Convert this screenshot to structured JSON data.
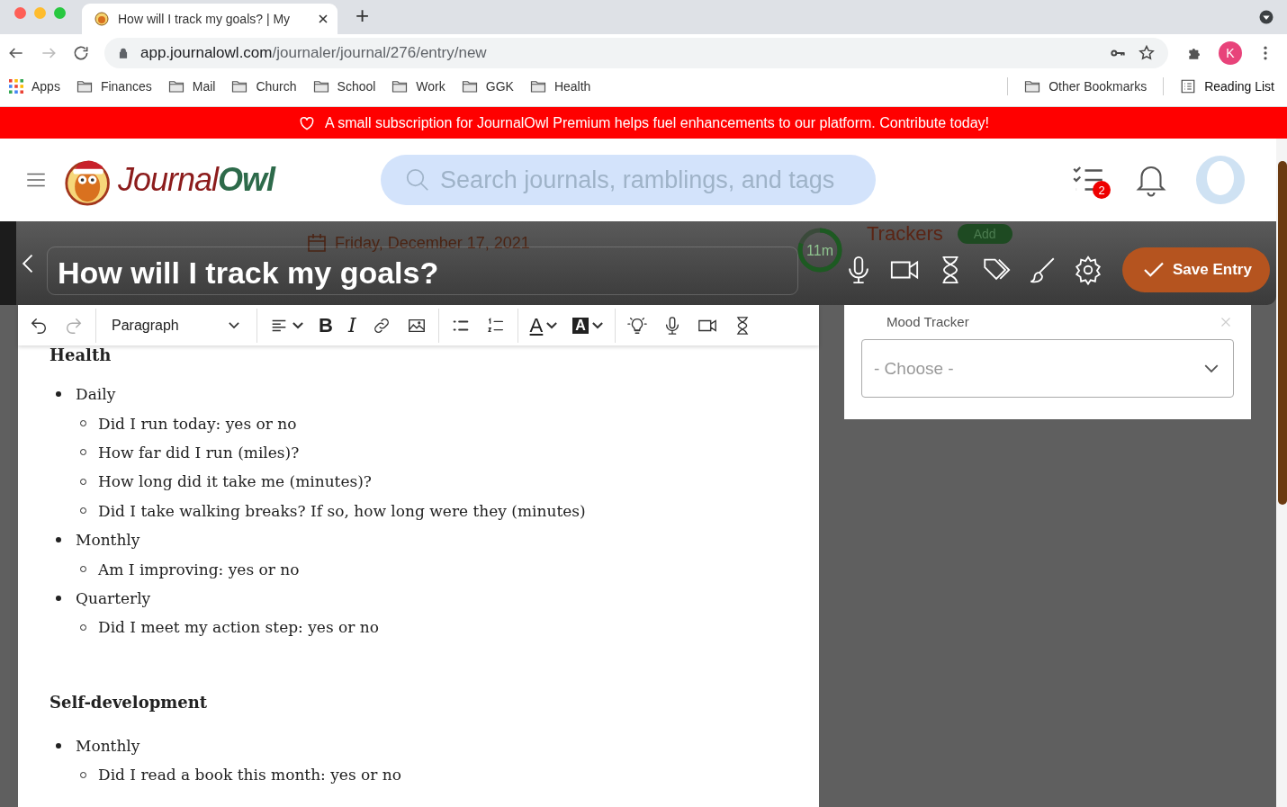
{
  "browser": {
    "tab_title": "How will I track my goals? | My",
    "new_tab": "+",
    "url_host": "app.journalowl.com",
    "url_path": "/journaler/journal/276/entry/new",
    "profile_initial": "K",
    "bookmarks": [
      {
        "label": "Apps",
        "kind": "apps"
      },
      {
        "label": "Finances",
        "kind": "folder"
      },
      {
        "label": "Mail",
        "kind": "folder"
      },
      {
        "label": "Church",
        "kind": "folder"
      },
      {
        "label": "School",
        "kind": "folder"
      },
      {
        "label": "Work",
        "kind": "folder"
      },
      {
        "label": "GGK",
        "kind": "folder"
      },
      {
        "label": "Health",
        "kind": "folder"
      }
    ],
    "bookmarks_right": [
      {
        "label": "Other Bookmarks",
        "kind": "folder"
      },
      {
        "label": "Reading List",
        "kind": "list"
      }
    ]
  },
  "banner": {
    "text": "A small subscription for JournalOwl Premium helps fuel enhancements to our platform. Contribute today!"
  },
  "header": {
    "logo": [
      "Journal",
      "Owl"
    ],
    "search": {
      "placeholder": "Search journals, ramblings, and tags"
    },
    "tasks_badge": "2"
  },
  "entry": {
    "title": "How will I track my goals?",
    "date": "Friday, December 17, 2021",
    "timer": {
      "label": "11m",
      "level": 0.8
    },
    "save_label": "Save Entry"
  },
  "toolbar": [
    {
      "kind": "undo"
    },
    {
      "kind": "redo"
    },
    {
      "kind": "select",
      "label": "Paragraph"
    },
    {
      "kind": "align"
    },
    {
      "kind": "bold",
      "label": "B"
    },
    {
      "kind": "italic",
      "label": "I"
    },
    {
      "kind": "link"
    },
    {
      "kind": "image"
    },
    {
      "kind": "bullets"
    },
    {
      "kind": "numbers"
    },
    {
      "kind": "color",
      "label": "A"
    },
    {
      "kind": "highlight",
      "label": "A"
    },
    {
      "kind": "bulb"
    },
    {
      "kind": "mic"
    },
    {
      "kind": "video"
    },
    {
      "kind": "hourglass"
    }
  ],
  "trackers": {
    "title": "Trackers",
    "add_label": "Add",
    "items": [
      {
        "name": "Mood Tracker",
        "placeholder": "- Choose -"
      }
    ]
  },
  "content": [
    {
      "heading": "Health",
      "items": [
        {
          "text": "Daily",
          "children": [
            {
              "text": "Did I run today: yes or no"
            },
            {
              "text": "How far did I run (miles)?"
            },
            {
              "text": "How long did it take me (minutes)?"
            },
            {
              "text": "Did I take walking breaks? If so, how long were they (minutes)"
            }
          ]
        },
        {
          "text": "Monthly",
          "children": [
            {
              "text": "Am I improving: yes or no"
            }
          ]
        },
        {
          "text": "Quarterly",
          "children": [
            {
              "text": "Did I meet my action step: yes or no"
            }
          ]
        }
      ]
    },
    {
      "heading": "Self-development",
      "items": [
        {
          "text": "Monthly",
          "children": [
            {
              "text": "Did I read a book this month: yes or no"
            }
          ]
        }
      ]
    }
  ]
}
